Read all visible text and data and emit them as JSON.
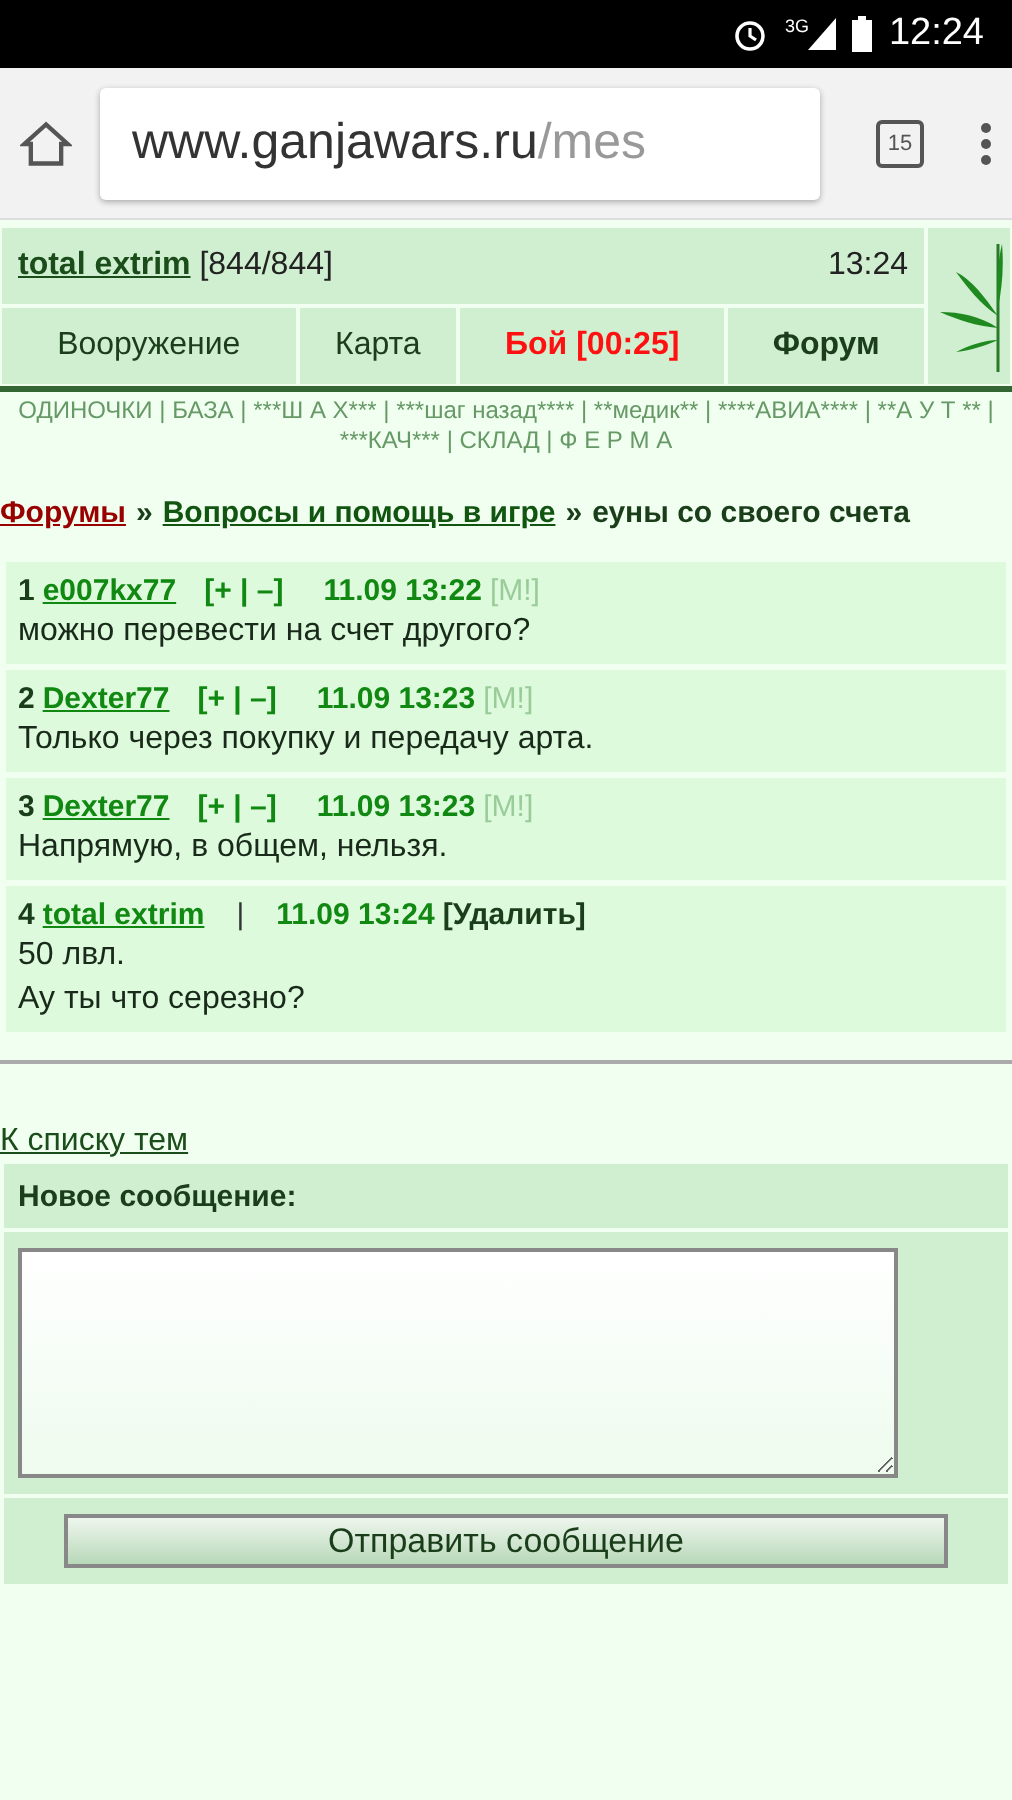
{
  "status_bar": {
    "network": "3G",
    "time": "12:24"
  },
  "browser": {
    "url_host": "www.ganjawars.ru",
    "url_path": "/mes",
    "tab_count": "15"
  },
  "header": {
    "user": "total extrim",
    "hp": "[844/844]",
    "time": "13:24"
  },
  "nav": [
    {
      "label": "Вооружение",
      "kind": "link"
    },
    {
      "label": "Карта",
      "kind": "link"
    },
    {
      "label": "Бой [00:25]",
      "kind": "alert"
    },
    {
      "label": "Форум",
      "kind": "current"
    }
  ],
  "clan_links": "ОДИНОЧКИ | БАЗА | ***Ш А Х*** | ***шаг назад**** | **медик** | ****АВИА**** | **А У Т ** | ***КАЧ*** | СКЛАД | Ф Е Р М А",
  "breadcrumb": {
    "items": [
      {
        "label": "Форумы",
        "kind": "root"
      },
      {
        "label": "Вопросы и помощь в игре",
        "kind": "section"
      }
    ],
    "separator": "»",
    "topic": "еуны со своего счета"
  },
  "posts": [
    {
      "number": "1",
      "author": "e007kx77",
      "vote": "[+ | –]",
      "datetime": "11.09 13:22",
      "action": "[M!]",
      "kind": "other",
      "lines": [
        "можно перевести на счет другого?"
      ]
    },
    {
      "number": "2",
      "author": "Dexter77",
      "vote": "[+ | –]",
      "datetime": "11.09 13:23",
      "action": "[M!]",
      "kind": "other",
      "lines": [
        "Только через покупку и передачу арта."
      ]
    },
    {
      "number": "3",
      "author": "Dexter77",
      "vote": "[+ | –]",
      "datetime": "11.09 13:23",
      "action": "[M!]",
      "kind": "other",
      "lines": [
        "Напрямую, в общем, нельзя."
      ]
    },
    {
      "number": "4",
      "author": "total extrim",
      "vote": "|",
      "datetime": "11.09 13:24",
      "action": "[Удалить]",
      "kind": "own",
      "lines": [
        "50 лвл.",
        "Ау ты что серезно?"
      ]
    }
  ],
  "back_link": "К списку тем",
  "reply_form": {
    "title": "Новое сообщение:",
    "submit": "Отправить сообщение"
  }
}
